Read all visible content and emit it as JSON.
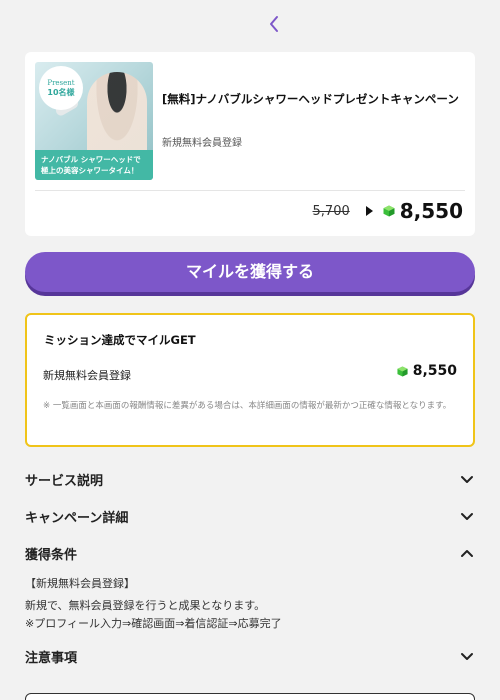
{
  "nav": {
    "back_icon": "chevron-left-icon"
  },
  "colors": {
    "accent": "#7d57c9",
    "accent_dark": "#573699",
    "mission_border": "#f0c419",
    "gem": "#3bbf3b",
    "thumb_caption_bg": "#43b8a5"
  },
  "offer": {
    "thumbnail": {
      "badge_line1": "Present",
      "badge_line2": "10名様",
      "caption_line1": "ナノバブル シャワーヘッドで",
      "caption_line2": "極上の美容シャワータイム！"
    },
    "title": "[無料]ナノバブルシャワーヘッドプレゼントキャンペーン",
    "subtitle": "新規無料会員登録",
    "old_price": "5,700",
    "new_price": "8,550"
  },
  "cta": {
    "label": "マイルを獲得する"
  },
  "mission": {
    "title": "ミッション達成でマイルGET",
    "item_label": "新規無料会員登録",
    "item_value": "8,550",
    "note": "※ 一覧画面と本画面の報酬情報に差異がある場合は、本詳細画面の情報が最新かつ正確な情報となります。"
  },
  "sections": {
    "service": {
      "label": "サービス説明",
      "icon": "chevron-down-icon"
    },
    "campaign": {
      "label": "キャンペーン詳細",
      "icon": "chevron-down-icon"
    },
    "conditions": {
      "label": "獲得条件",
      "icon": "chevron-up-icon",
      "line1": "【新規無料会員登録】",
      "line2": "新規で、無料会員登録を行うと成果となります。",
      "line3": "※プロフィール入力⇒確認画面⇒着信認証⇒応募完了"
    },
    "notes": {
      "label": "注意事項",
      "icon": "chevron-down-icon"
    }
  }
}
